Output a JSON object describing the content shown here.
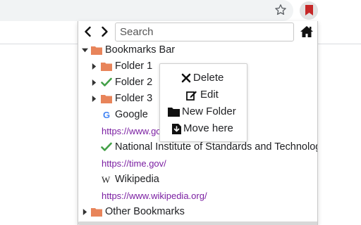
{
  "browser": {
    "bookmark_star_icon": "star-outline-icon",
    "extension_icon": "bookmark-ribbon-icon",
    "accent_color": "#c62828"
  },
  "popup": {
    "search": {
      "placeholder": "Search",
      "value": ""
    },
    "nav": {
      "back_icon": "chevron-left-icon",
      "forward_icon": "chevron-right-icon",
      "home_icon": "home-icon"
    },
    "tree": [
      {
        "label": "Bookmarks Bar",
        "kind": "folder",
        "expanded": true
      },
      {
        "label": "Folder 1",
        "kind": "folder",
        "expanded": false
      },
      {
        "label": "Folder 2",
        "kind": "folder",
        "expanded": false,
        "checked": true
      },
      {
        "label": "Folder 3",
        "kind": "folder",
        "expanded": false
      },
      {
        "label": "Google",
        "kind": "bookmark",
        "favicon": "google-g-icon",
        "url": "https://www.go"
      },
      {
        "label": "National Institute of Standards and Technolog",
        "kind": "bookmark",
        "checked": true,
        "url": "https://time.gov/"
      },
      {
        "label": "Wikipedia",
        "kind": "bookmark",
        "favicon": "wikipedia-w-icon",
        "url": "https://www.wikipedia.org/"
      },
      {
        "label": "Other Bookmarks",
        "kind": "folder",
        "expanded": false
      }
    ],
    "colors": {
      "folder": "#e8845a",
      "check": "#43a047",
      "url": "#7b1fa2"
    }
  },
  "context_menu": {
    "items": [
      {
        "label": "Delete",
        "icon": "x-icon"
      },
      {
        "label": "Edit",
        "icon": "edit-icon"
      },
      {
        "label": "New Folder",
        "icon": "folder-icon"
      },
      {
        "label": "Move here",
        "icon": "download-icon"
      }
    ]
  }
}
